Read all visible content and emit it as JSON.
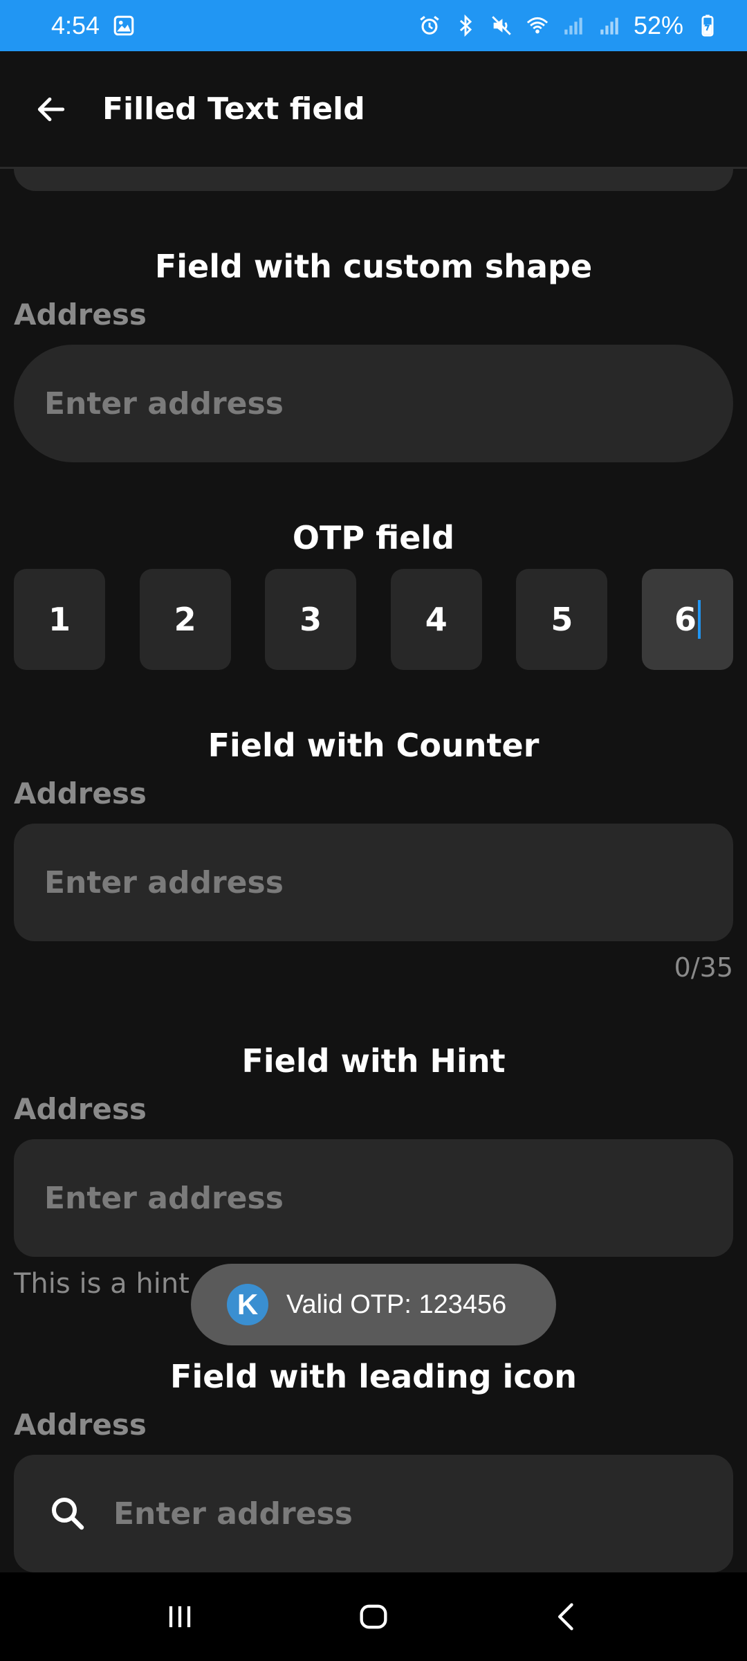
{
  "status_bar": {
    "time": "4:54",
    "battery": "52%"
  },
  "app_bar": {
    "title": "Filled Text field"
  },
  "sections": {
    "custom_shape": {
      "title": "Field with custom shape",
      "label": "Address",
      "placeholder": "Enter address"
    },
    "otp": {
      "title": "OTP field",
      "digits": [
        "1",
        "2",
        "3",
        "4",
        "5",
        "6"
      ]
    },
    "counter": {
      "title": "Field with Counter",
      "label": "Address",
      "placeholder": "Enter address",
      "count": "0/35"
    },
    "hint": {
      "title": "Field with Hint",
      "label": "Address",
      "placeholder": "Enter address",
      "hint_text": "This is a hint"
    },
    "leading_icon": {
      "title": "Field with leading icon",
      "label": "Address",
      "placeholder": "Enter address",
      "icon": "search-icon"
    }
  },
  "toast": {
    "icon_letter": "K",
    "message": "Valid OTP: 123456"
  },
  "colors": {
    "status_bar": "#2196f3",
    "background": "#121212",
    "field": "#282828",
    "caret": "#2196f3"
  }
}
